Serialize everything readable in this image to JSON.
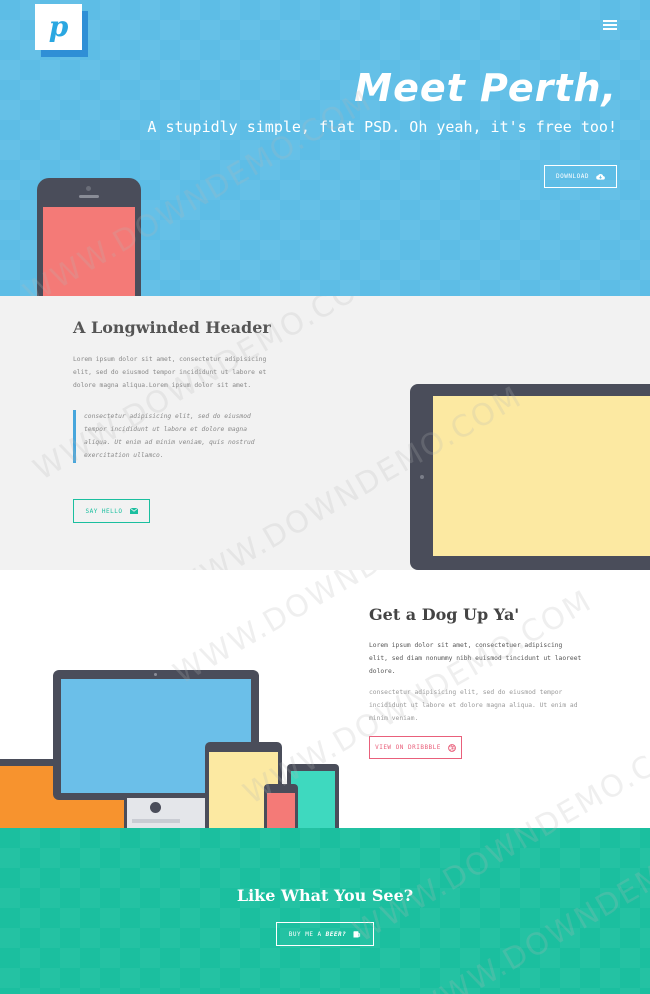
{
  "brand": {
    "logo_letter": "p"
  },
  "hero": {
    "title": "Meet Perth,",
    "subtitle": "A stupidly simple, flat PSD. Oh yeah, it's free too!",
    "download_label": "DOWNLOAD"
  },
  "section_one": {
    "title": "A Longwinded Header",
    "body": "Lorem ipsum dolor sit amet, consectetur adipisicing elit, sed do eiusmod tempor incididunt ut labore et dolore magna aliqua.Lorem ipsum dolor sit amet.",
    "quote": "consectetur adipisicing elit, sed do eiusmod tempor incididunt ut labore et dolore magna aliqua. Ut enim ad minim veniam, quis nostrud exercitation ullamco.",
    "button_label": "SAY HELLO"
  },
  "section_two": {
    "title": "Get a Dog Up Ya'",
    "body_strong": "Lorem ipsum dolor sit amet, consectetuer adipiscing elit, sed diam nonummy nibh euismod tincidunt ut laoreet dolore.",
    "body_light": "consectetur adipisicing elit, sed do eiusmod tempor incididunt ut labore et dolore magna aliqua. Ut enim ad minim veniam.",
    "button_label": "VIEW ON DRIBBBLE"
  },
  "cta": {
    "title": "Like What You See?",
    "button_prefix": "BUY ME A",
    "button_emphasis": "BEER?"
  },
  "watermark": "WWW.DOWNDEMO.COM",
  "colors": {
    "hero_bg": "#5dbde6",
    "section_light": "#f2f2f2",
    "teal": "#1bbf9f",
    "pink": "#e9607b",
    "device_dark": "#4a4d5a",
    "coral": "#f47a77",
    "yellow": "#fce9a2",
    "orange": "#f7932e"
  },
  "icons": [
    "menu-icon",
    "cloud-download-icon",
    "envelope-icon",
    "dribbble-icon",
    "beer-icon"
  ]
}
